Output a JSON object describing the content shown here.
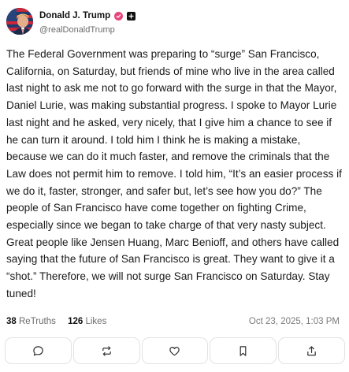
{
  "post": {
    "display_name": "Donald J. Trump",
    "handle": "@realDonaldTrump",
    "avatar_icon": "profile-photo-avatar",
    "verified_icon": "verified-badge-icon",
    "plus_icon": "plus-square-icon",
    "body": "The Federal Government was preparing to “surge” San Francisco, California, on Saturday, but friends of mine who live in the area called last night to ask me not to go forward with the surge in that the Mayor, Daniel Lurie, was making substantial progress. I spoke to Mayor Lurie last night and he asked, very nicely, that I give him a chance to see if he can turn it around. I told him I think he is making a mistake, because we can do it much faster, and remove the criminals that the Law does not permit him to remove. I told him, “It’s an easier process if we do it, faster, stronger, and safer but, let’s see how you do?” The people of San Francisco have come together on fighting Crime, especially since we began to take charge of that very nasty subject. Great people like Jensen Huang, Marc Benioff, and others have called saying that the future of San Francisco is great. They want to give it a “shot.” Therefore, we will not surge San Francisco on Saturday. Stay tuned!",
    "retruths_count": "38",
    "retruths_label": "ReTruths",
    "likes_count": "126",
    "likes_label": "Likes",
    "timestamp": "Oct 23, 2025, 1:03 PM"
  },
  "actions": [
    {
      "name": "reply-button",
      "icon": "speech-bubble-icon"
    },
    {
      "name": "retruth-button",
      "icon": "repost-arrows-icon"
    },
    {
      "name": "like-button",
      "icon": "heart-icon"
    },
    {
      "name": "bookmark-button",
      "icon": "bookmark-icon"
    },
    {
      "name": "share-button",
      "icon": "share-upload-icon"
    }
  ],
  "colors": {
    "text": "#1a1a1a",
    "muted": "#6b6b6b",
    "verified": "#e6467a",
    "border": "#e2e2e2"
  }
}
